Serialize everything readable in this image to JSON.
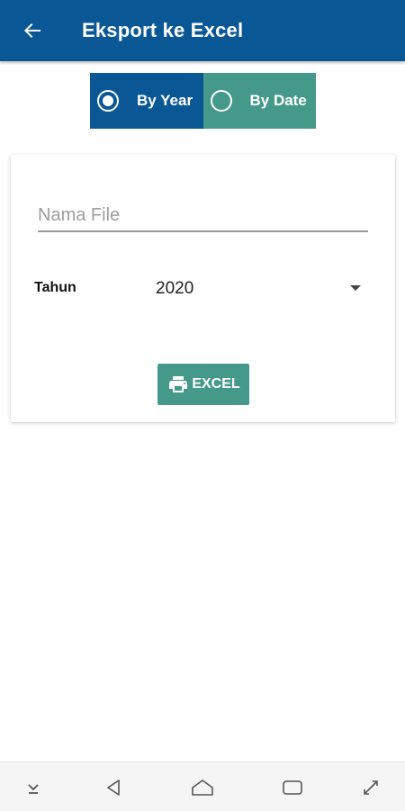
{
  "appbar": {
    "title": "Eksport ke Excel",
    "back_icon": "arrow-left-icon",
    "background": "#0a5796"
  },
  "mode_toggle": {
    "selected": "By Year",
    "options": [
      {
        "label": "By Year",
        "selected": true,
        "color": "#0a5796"
      },
      {
        "label": "By Date",
        "selected": false,
        "color": "#45998a"
      }
    ]
  },
  "form": {
    "file_name": {
      "placeholder": "Nama File",
      "value": ""
    },
    "year": {
      "label": "Tahun",
      "selected": "2020"
    },
    "export_button": {
      "label": "EXCEL",
      "icon": "printer-icon",
      "color": "#45998a"
    }
  },
  "system_nav": {
    "icons": [
      "hide-keyboard-icon",
      "back-triangle-icon",
      "home-icon",
      "recents-icon",
      "expand-icon"
    ]
  }
}
